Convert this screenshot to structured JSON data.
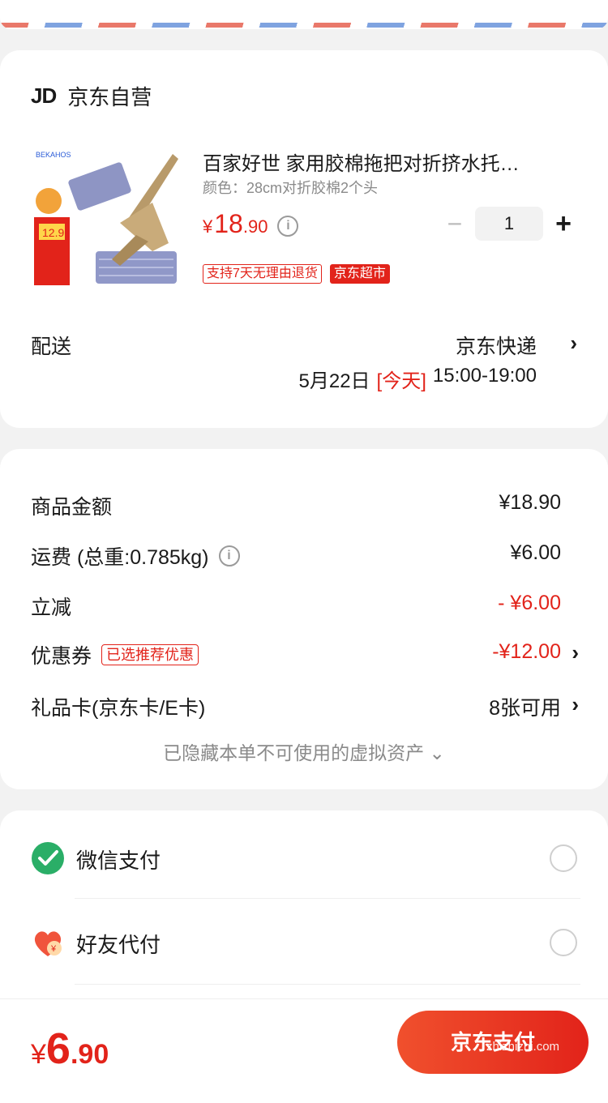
{
  "shop": {
    "logo": "JD",
    "name": "京东自营"
  },
  "product": {
    "title": "百家好世 家用胶棉拖把对折挤水托…",
    "spec": "颜色：28cm对折胶棉2个头",
    "price_currency": "¥",
    "price_int": "18",
    "price_dec": ".90",
    "quantity": "1",
    "tags": [
      "支持7天无理由退货",
      "京东超市"
    ],
    "image_icon": "mop-product-image"
  },
  "delivery": {
    "label": "配送",
    "method": "京东快递",
    "date": "5月22日",
    "today": "[今天]",
    "time": "15:00-19:00"
  },
  "summary": {
    "goods_label": "商品金额",
    "goods_value": "¥18.90",
    "freight_label": "运费 (总重:0.785kg)",
    "freight_value": "¥6.00",
    "discount_label": "立减",
    "discount_value": "- ¥6.00",
    "coupon_label": "优惠券",
    "coupon_tag": "已选推荐优惠",
    "coupon_value": "-¥12.00",
    "giftcard_label": "礼品卡(京东卡/E卡)",
    "giftcard_value": "8张可用",
    "hidden_note": "已隐藏本单不可使用的虚拟资产 ⌄"
  },
  "payment": {
    "wechat_label": "微信支付",
    "friend_label": "好友代付"
  },
  "footer": {
    "total_currency": "¥",
    "total_int": "6",
    "total_dec": ".90",
    "pay_button": "京东支付",
    "watermark": "zhizhizhi.com"
  },
  "colors": {
    "accent": "#e2231a",
    "wechat": "#2aae67"
  }
}
